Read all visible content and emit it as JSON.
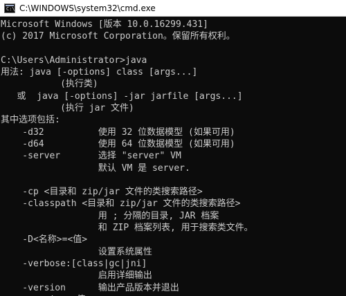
{
  "window": {
    "title": "C:\\WINDOWS\\system32\\cmd.exe",
    "icon": "cmd-icon",
    "background": "#0c0c0c",
    "text_color": "#cccccc"
  },
  "console": {
    "lines": [
      "Microsoft Windows [版本 10.0.16299.431]",
      "(c) 2017 Microsoft Corporation。保留所有权利。",
      "",
      "C:\\Users\\Administrator>java",
      "用法: java [-options] class [args...]",
      "           (执行类)",
      "   或  java [-options] -jar jarfile [args...]",
      "           (执行 jar 文件)",
      "其中选项包括:",
      "    -d32          使用 32 位数据模型 (如果可用)",
      "    -d64          使用 64 位数据模型 (如果可用)",
      "    -server       选择 \"server\" VM",
      "                  默认 VM 是 server.",
      "",
      "    -cp <目录和 zip/jar 文件的类搜索路径>",
      "    -classpath <目录和 zip/jar 文件的类搜索路径>",
      "                  用 ; 分隔的目录, JAR 档案",
      "                  和 ZIP 档案列表, 用于搜索类文件。",
      "    -D<名称>=<值>",
      "                  设置系统属性",
      "    -verbose:[class|gc|jni]",
      "                  启用详细输出",
      "    -version      输出产品版本并退出",
      "    -version:<值>"
    ]
  }
}
